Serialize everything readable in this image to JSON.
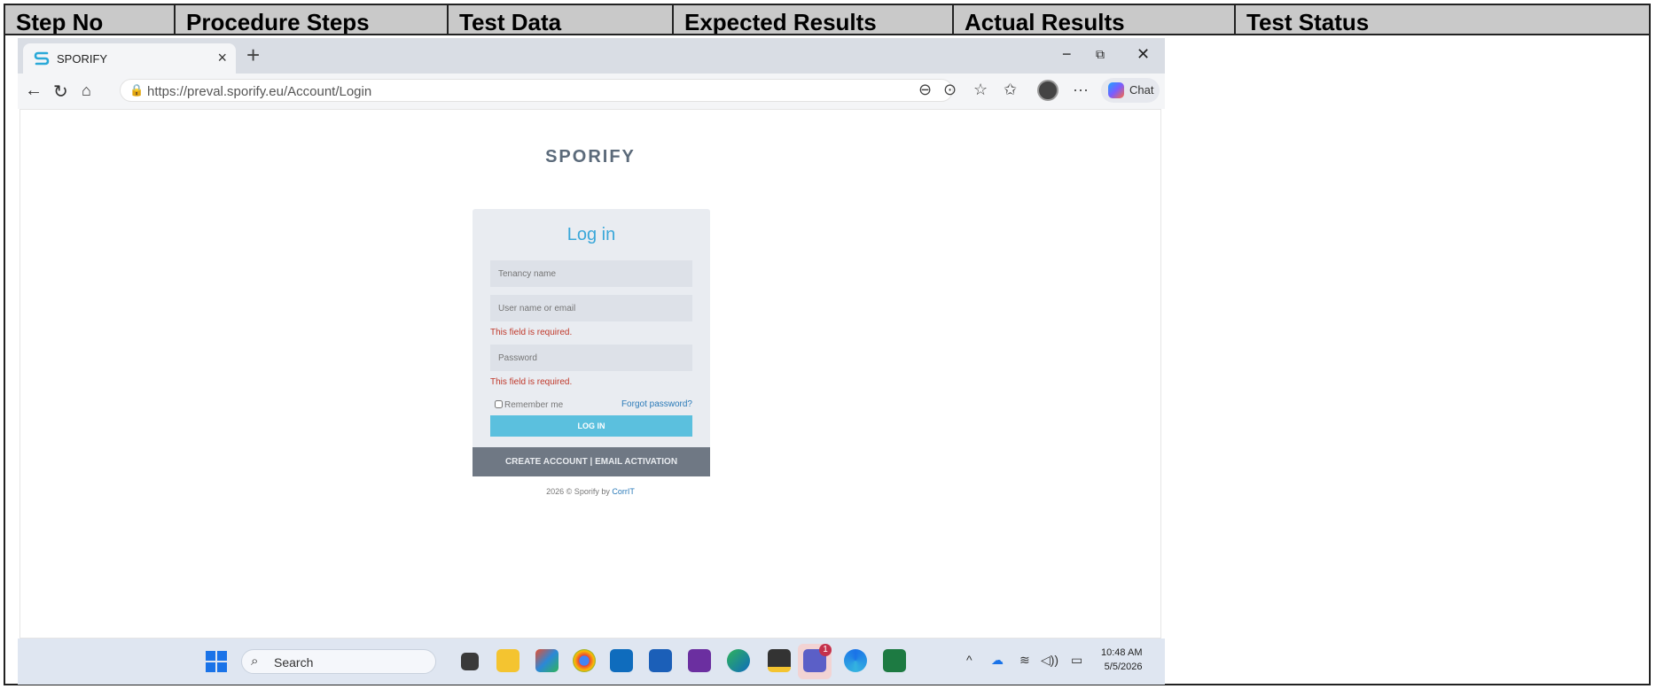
{
  "table": {
    "headers": [
      "Step No",
      "Procedure Steps",
      "Test Data",
      "Expected Results",
      "Actual Results",
      "Test Status"
    ]
  },
  "browser": {
    "tab_title": "SPORIFY",
    "tab_close": "×",
    "new_tab": "+",
    "minimize": "−",
    "restore": "⧉",
    "close": "✕",
    "url": "https://preval.sporify.eu/Account/Login",
    "chat_label": "Chat"
  },
  "login": {
    "brand": "SPORIFY",
    "title": "Log in",
    "tenancy_placeholder": "Tenancy name",
    "username_placeholder": "User name or email",
    "username_error": "This field is required.",
    "password_placeholder": "Password",
    "password_error": "This field is required.",
    "remember_label": "Remember me",
    "forgot_label": "Forgot password?",
    "login_button": "LOG IN",
    "footer_links": "CREATE ACCOUNT | EMAIL ACTIVATION",
    "copyright_prefix": "2026 © Sporify by ",
    "copyright_link": "CorrIT"
  },
  "taskbar": {
    "search_label": "Search",
    "teams_badge": "1",
    "time": "10:48 AM",
    "date": "5/5/2026"
  },
  "colors": {
    "accent": "#3aa7d9",
    "login_button": "#5bc0de",
    "error": "#c0392b",
    "card_footer": "#6f7884"
  }
}
